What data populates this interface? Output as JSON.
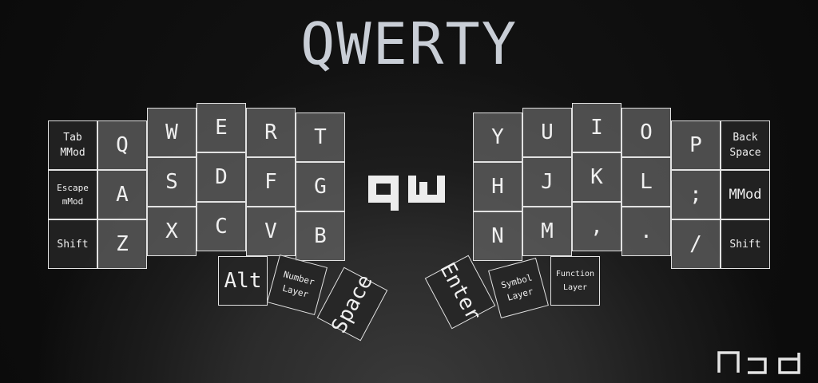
{
  "title": "QWERTY",
  "layer_icon": "qw-logo-icon",
  "brand_icon": "njd-logo-icon",
  "colors": {
    "key_fill": "#5f5f5f",
    "key_fill_dark": "#262626",
    "key_border": "#e2e2e2",
    "text": "#f0f0f0",
    "title": "#c9ced6"
  },
  "keys": {
    "tab_mmod": "Tab\nMMod",
    "escape_mmod": "Escape\nmMod",
    "shift_left": "Shift",
    "q": "Q",
    "a": "A",
    "z": "Z",
    "w": "W",
    "s": "S",
    "x": "X",
    "e": "E",
    "d": "D",
    "c": "C",
    "r": "R",
    "f": "F",
    "v": "V",
    "t": "T",
    "g": "G",
    "b": "B",
    "y": "Y",
    "h": "H",
    "n": "N",
    "u": "U",
    "j": "J",
    "m": "M",
    "i": "I",
    "k": "K",
    "comma": ",",
    "o": "O",
    "l": "L",
    "period": ".",
    "p": "P",
    "semicolon": ";",
    "slash": "/",
    "backspace": "Back\nSpace",
    "mmod_right": "MMod",
    "shift_right": "Shift",
    "alt": "Alt",
    "number_layer": "Number\nLayer",
    "space": "Space",
    "enter": "Enter",
    "symbol_layer": "Symbol\nLayer",
    "function_layer": "Function\nLayer"
  }
}
